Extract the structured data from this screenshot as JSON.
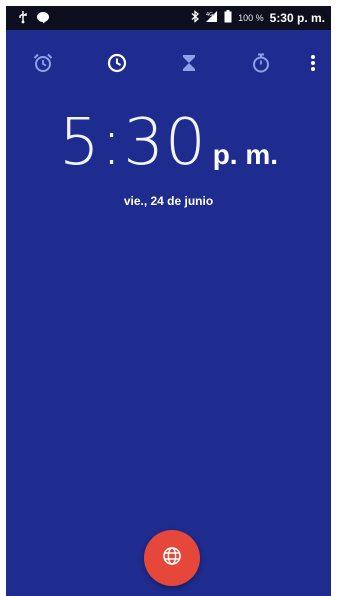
{
  "status_bar": {
    "icons": [
      "usb-icon",
      "chat-bubble-icon",
      "bluetooth-icon",
      "signal-icon",
      "battery-icon"
    ],
    "battery_percent": "100 %",
    "time": "5:30 p. m."
  },
  "toolbar": {
    "tabs": [
      {
        "name": "alarm",
        "icon": "alarm-clock-icon"
      },
      {
        "name": "clock",
        "icon": "clock-icon",
        "selected": true
      },
      {
        "name": "timer",
        "icon": "hourglass-icon"
      },
      {
        "name": "stopwatch",
        "icon": "stopwatch-icon"
      }
    ],
    "more_icon": "more-vert-icon"
  },
  "clock": {
    "time": "5:30",
    "ampm": "p. m.",
    "date": "vie., 24 de junio"
  },
  "fab": {
    "icon": "globe-icon"
  },
  "colors": {
    "background": "#1f2c8f",
    "status_bar": "#0d0f1e",
    "fab": "#e5483b"
  }
}
